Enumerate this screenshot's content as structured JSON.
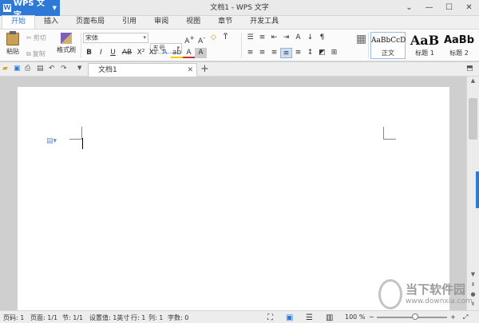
{
  "app": {
    "name": "WPS 文字",
    "window_title": "文档1 - WPS 文字"
  },
  "menu": {
    "tabs": [
      "开始",
      "插入",
      "页面布局",
      "引用",
      "审阅",
      "视图",
      "章节",
      "开发工具"
    ]
  },
  "ribbon": {
    "paste_label": "粘贴",
    "cut_label": "剪切",
    "copy_label": "复制",
    "format_painter_label": "格式刷",
    "font_name": "宋体",
    "font_size": "五号",
    "styles": [
      {
        "preview": "AaBbCcD",
        "label": "正文"
      },
      {
        "preview": "AaB",
        "label": "标题 1"
      },
      {
        "preview": "AaBb",
        "label": "标题 2"
      }
    ]
  },
  "doc_tab": {
    "label": "文档1"
  },
  "status": {
    "page_num": "页码: 1",
    "page_total": "页面: 1/1",
    "section": "节: 1/1",
    "settings": "设置值: 1英寸",
    "row": "行: 1",
    "col": "列: 1",
    "words": "字数: 0",
    "zoom": "100 %"
  },
  "watermark": {
    "title": "当下软件园",
    "url": "www.downxia.com"
  },
  "colors": {
    "accent": "#2e78d6",
    "font_color_bar": "#d03030",
    "highlight_bar": "#f0d000"
  }
}
